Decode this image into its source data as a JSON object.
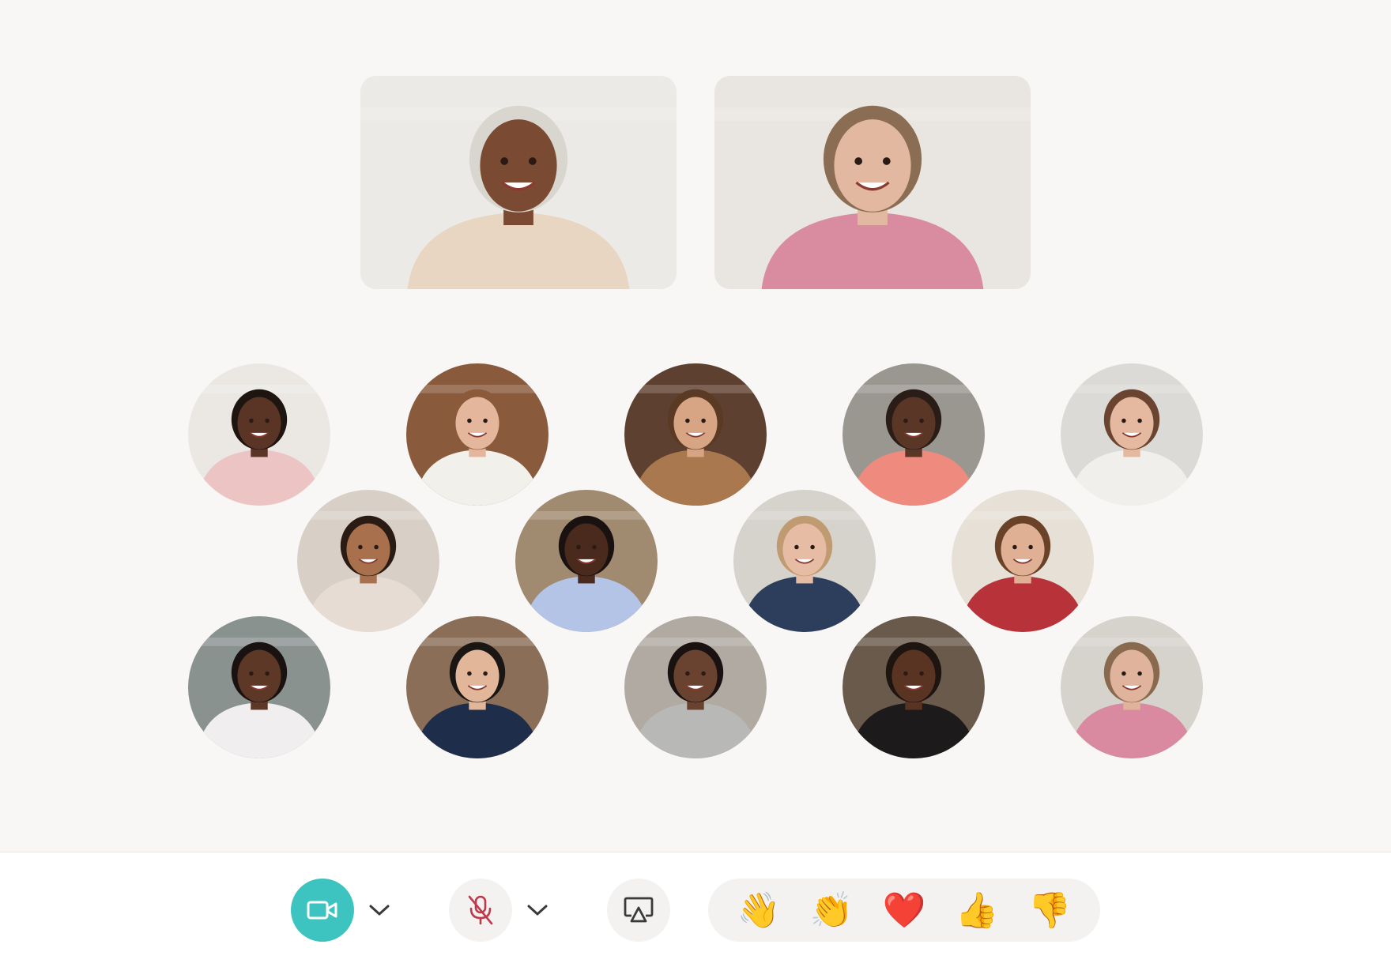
{
  "featured": [
    {
      "id": "presenter-1",
      "bg": "#eceae6",
      "skin": "#7a4a32",
      "hair": "#d9d5cf",
      "shirt": "#e8d6c2"
    },
    {
      "id": "presenter-2",
      "bg": "#e9e6e1",
      "skin": "#e2b9a0",
      "hair": "#8a6d52",
      "shirt": "#d98ca0"
    }
  ],
  "participants": [
    {
      "name": "participant-1",
      "bg": "#ebe8e4",
      "skin": "#5a3424",
      "hair": "#1e1410",
      "shirt": "#ecc4c4"
    },
    {
      "name": "participant-2",
      "bg": "#8a5a3c",
      "skin": "#e4b79c",
      "hair": "#8a5a3a",
      "shirt": "#f2f0ea"
    },
    {
      "name": "participant-3",
      "bg": "#5e4030",
      "skin": "#d8a584",
      "hair": "#5a3a22",
      "shirt": "#a9784e"
    },
    {
      "name": "participant-4",
      "bg": "#9a9690",
      "skin": "#5a3626",
      "hair": "#2a1c16",
      "shirt": "#ee8a7e"
    },
    {
      "name": "participant-5",
      "bg": "#dcdad6",
      "skin": "#e4b9a0",
      "hair": "#6a4430",
      "shirt": "#f0efec"
    },
    {
      "name": "participant-6",
      "bg": "#d8d0c6",
      "skin": "#a8704c",
      "hair": "#2a1c14",
      "shirt": "#e6dcd4"
    },
    {
      "name": "participant-7",
      "bg": "#a08a70",
      "skin": "#4a2a1c",
      "hair": "#1a1210",
      "shirt": "#b4c4e6"
    },
    {
      "name": "participant-8",
      "bg": "#d6d2cc",
      "skin": "#e6bda4",
      "hair": "#c09a70",
      "shirt": "#2c3e5c"
    },
    {
      "name": "participant-9",
      "bg": "#e6e0d6",
      "skin": "#e0b094",
      "hair": "#6a4228",
      "shirt": "#b8323a"
    },
    {
      "name": "participant-10",
      "bg": "#8a9290",
      "skin": "#5e3826",
      "hair": "#1a1210",
      "shirt": "#f0eeee"
    },
    {
      "name": "participant-11",
      "bg": "#8a6e58",
      "skin": "#e2b698",
      "hair": "#1a1614",
      "shirt": "#1e2e4a"
    },
    {
      "name": "participant-12",
      "bg": "#b0aaa2",
      "skin": "#6a4230",
      "hair": "#1a1210",
      "shirt": "#b8b8b6"
    },
    {
      "name": "participant-13",
      "bg": "#6a5a4c",
      "skin": "#5a3422",
      "hair": "#1e1410",
      "shirt": "#1c1a1a"
    },
    {
      "name": "participant-14",
      "bg": "#d6d2cc",
      "skin": "#e0b49c",
      "hair": "#8a6a4e",
      "shirt": "#d98aa0"
    }
  ],
  "controls": {
    "camera_icon": "video-camera-icon",
    "mic_icon": "microphone-muted-icon",
    "share_icon": "screen-share-icon",
    "accent": "#3ec4c0",
    "mute_color": "#c0394b"
  },
  "reactions": [
    {
      "name": "wave",
      "emoji": "👋"
    },
    {
      "name": "clap",
      "emoji": "👏"
    },
    {
      "name": "heart",
      "emoji": "❤️"
    },
    {
      "name": "thumbs-up",
      "emoji": "👍"
    },
    {
      "name": "thumbs-down",
      "emoji": "👎"
    }
  ]
}
